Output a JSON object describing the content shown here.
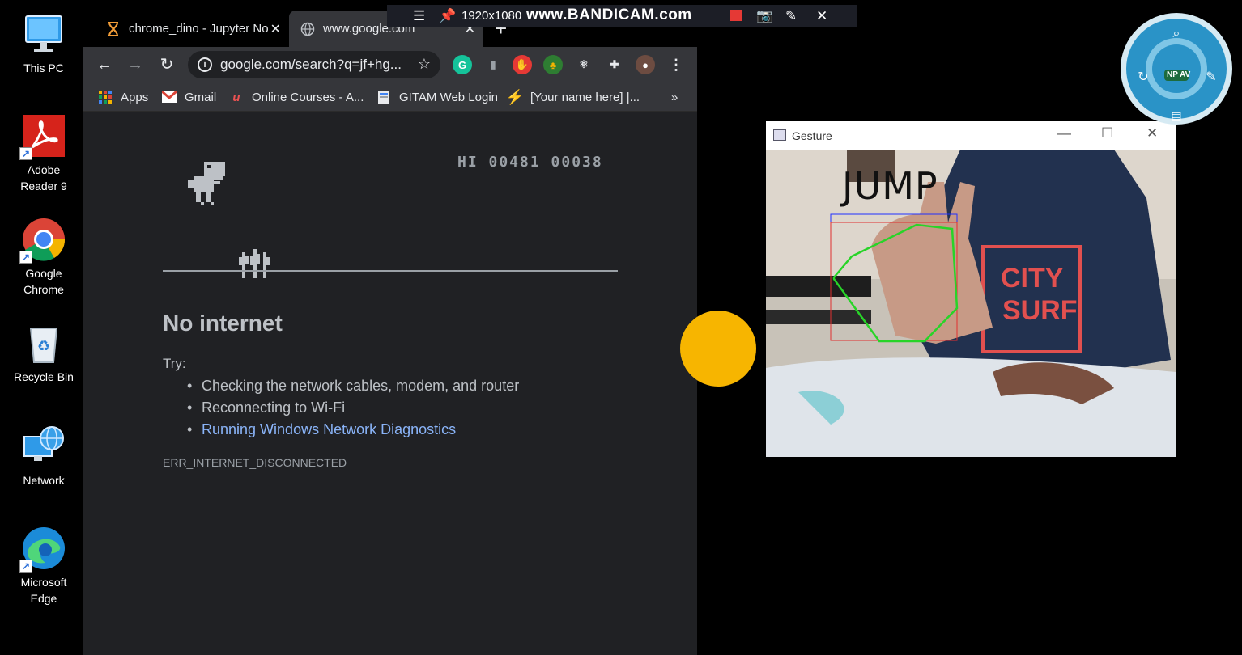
{
  "desktop": {
    "icons": [
      {
        "label": "This PC"
      },
      {
        "label": "Adobe Reader 9"
      },
      {
        "label": "Google Chrome"
      },
      {
        "label": "Recycle Bin"
      },
      {
        "label": "Network"
      },
      {
        "label": "Microsoft Edge"
      }
    ]
  },
  "browser": {
    "tabs": [
      {
        "title": "chrome_dino - Jupyter No",
        "icon": "hourglass-icon"
      },
      {
        "title": "www.google.com",
        "icon": "globe-icon"
      }
    ],
    "new_tab": "+",
    "url": "google.com/search?q=jf+hg...",
    "bookmarks": [
      {
        "label": "Apps",
        "icon": "apps-grid-icon"
      },
      {
        "label": "Gmail",
        "icon": "gmail-icon"
      },
      {
        "label": "Online Courses - A...",
        "icon": "udemy-icon"
      },
      {
        "label": "GITAM Web Login",
        "icon": "page-icon"
      },
      {
        "label": "[Your name here] |...",
        "icon": "bolt-icon"
      }
    ],
    "bookmarks_overflow": "»"
  },
  "dino_page": {
    "score": "HI 00481 00038",
    "heading": "No internet",
    "try_label": "Try:",
    "suggestions": [
      "Checking the network cables, modem, and router",
      "Reconnecting to Wi-Fi",
      "Running Windows Network Diagnostics"
    ],
    "error_code": "ERR_INTERNET_DISCONNECTED"
  },
  "bandicam": {
    "resolution": "1920x1080",
    "brand": "www.BANDICAM.com"
  },
  "gesture_window": {
    "title": "Gesture",
    "overlay_text": "JUMP",
    "shirt_text_line1": "CITY",
    "shirt_text_line2": "SURF"
  },
  "npav": {
    "label": "NP AV"
  },
  "colors": {
    "chrome_bg": "#202124",
    "toolbar": "#35363a",
    "link": "#8ab4f8",
    "circle": "#f7b500"
  }
}
